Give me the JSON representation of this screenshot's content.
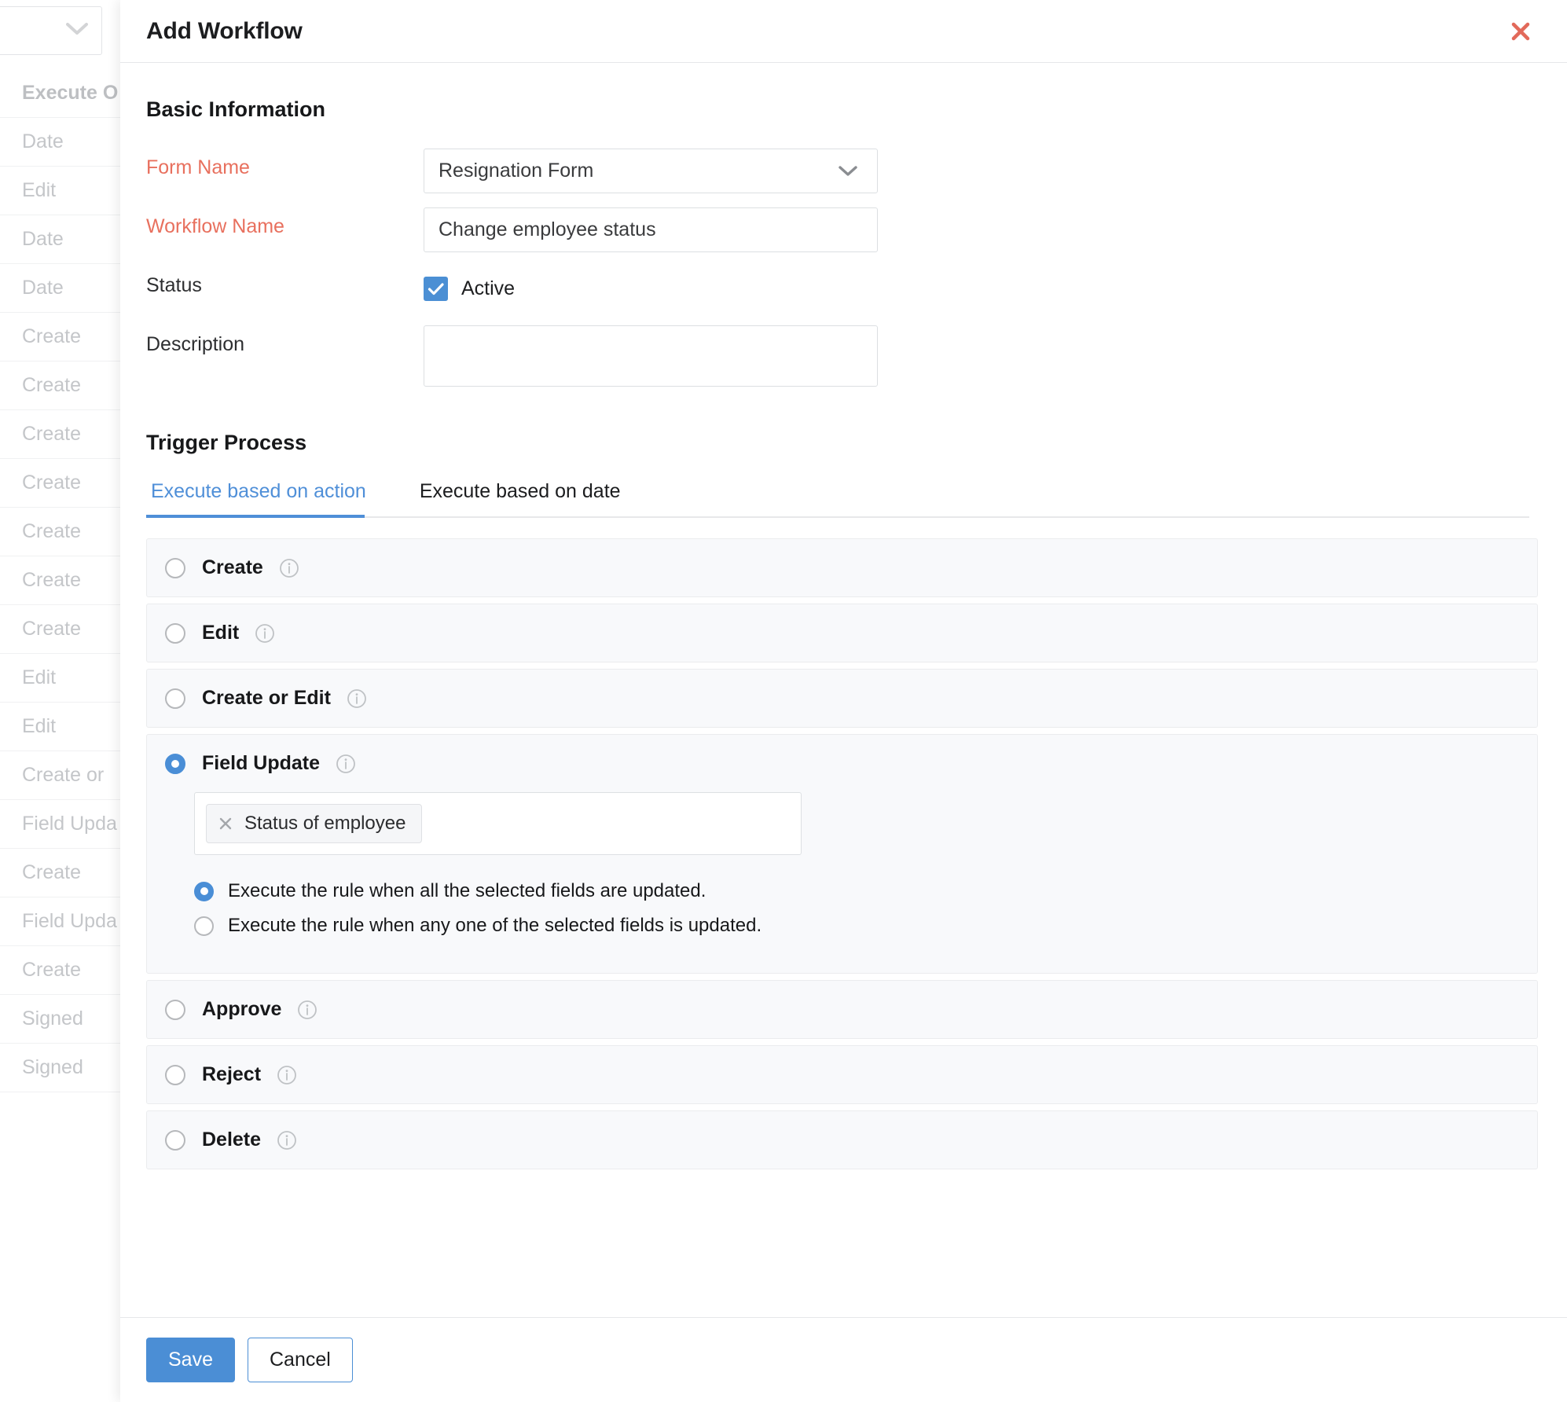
{
  "background": {
    "toolbar_icon": "chevron-down-icon",
    "column_rows": [
      "Execute O",
      "Date",
      "Edit",
      "Date",
      "Date",
      "Create",
      "Create",
      "Create",
      "Create",
      "Create",
      "Create",
      "Create",
      "Edit",
      "Edit",
      "Create or",
      "Field Upda",
      "Create",
      "Field Upda",
      "Create",
      "Signed",
      "Signed"
    ]
  },
  "modal": {
    "title": "Add Workflow",
    "close_icon": "close-icon",
    "basic_information": {
      "heading": "Basic Information",
      "form_name_label": "Form Name",
      "form_name_value": "Resignation Form",
      "form_name_chevron": "chevron-down-icon",
      "workflow_name_label": "Workflow Name",
      "workflow_name_value": "Change employee status",
      "status_label": "Status",
      "status_checkbox_checked": true,
      "status_checkbox_label": "Active",
      "description_label": "Description",
      "description_value": ""
    },
    "trigger_process": {
      "heading": "Trigger Process",
      "tabs": [
        {
          "label": "Execute based on action",
          "active": true
        },
        {
          "label": "Execute based on date",
          "active": false
        }
      ],
      "options": [
        {
          "label": "Create",
          "selected": false,
          "info_icon": "info-icon"
        },
        {
          "label": "Edit",
          "selected": false,
          "info_icon": "info-icon"
        },
        {
          "label": "Create or Edit",
          "selected": false,
          "info_icon": "info-icon"
        },
        {
          "label": "Field Update",
          "selected": true,
          "info_icon": "info-icon"
        },
        {
          "label": "Approve",
          "selected": false,
          "info_icon": "info-icon"
        },
        {
          "label": "Reject",
          "selected": false,
          "info_icon": "info-icon"
        },
        {
          "label": "Delete",
          "selected": false,
          "info_icon": "info-icon"
        }
      ],
      "field_update": {
        "chip_label": "Status of employee",
        "chip_remove_icon": "close-icon",
        "sub_options": [
          {
            "label": "Execute the rule when all the selected fields are updated.",
            "selected": true
          },
          {
            "label": "Execute the rule when any one of the selected fields is updated.",
            "selected": false
          }
        ]
      }
    },
    "footer": {
      "save_label": "Save",
      "cancel_label": "Cancel"
    }
  },
  "colors": {
    "accent": "#4b8ed5",
    "required": "#e8705e",
    "close": "#e2695a",
    "panel": "#f8f9fb"
  }
}
